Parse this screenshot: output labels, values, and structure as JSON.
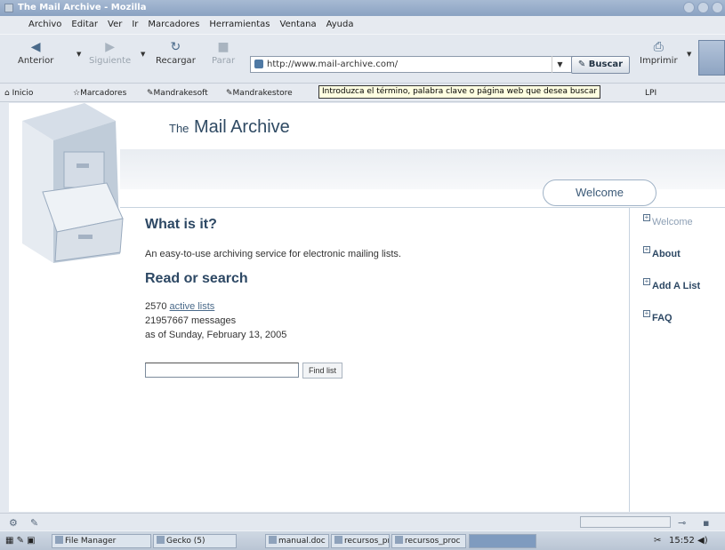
{
  "window": {
    "title": "The Mail Archive - Mozilla"
  },
  "menu": [
    "Archivo",
    "Editar",
    "Ver",
    "Ir",
    "Marcadores",
    "Herramientas",
    "Ventana",
    "Ayuda"
  ],
  "nav": {
    "back": "Anterior",
    "forward": "Siguiente",
    "reload": "Recargar",
    "stop": "Parar",
    "url": "http://www.mail-archive.com/",
    "search": "Buscar",
    "print": "Imprimir"
  },
  "bookmarks": [
    "Inicio",
    "Marcadores",
    "Mandrakesoft",
    "Mandrakestore",
    "LPI"
  ],
  "tooltip": "Introduzca el término, palabra clave o página web que desea buscar",
  "site": {
    "title_prefix": "The",
    "title_main": "Mail Archive",
    "welcome_tab": "Welcome",
    "what_heading": "What is it?",
    "what_text": "An easy-to-use archiving service for electronic mailing lists.",
    "read_heading": "Read or search",
    "lists_count": "2570",
    "lists_link": "active lists",
    "messages": "21957667 messages",
    "as_of": "as of Sunday, February 13, 2005",
    "find_button": "Find list",
    "sidebar": [
      "Welcome",
      "About",
      "Add A List",
      "FAQ"
    ]
  },
  "taskbar": {
    "items": [
      "File Manager",
      "Gecko (5)",
      "manual.doc -",
      "recursos_pro",
      "recursos_proc"
    ],
    "clock": "15:52"
  }
}
